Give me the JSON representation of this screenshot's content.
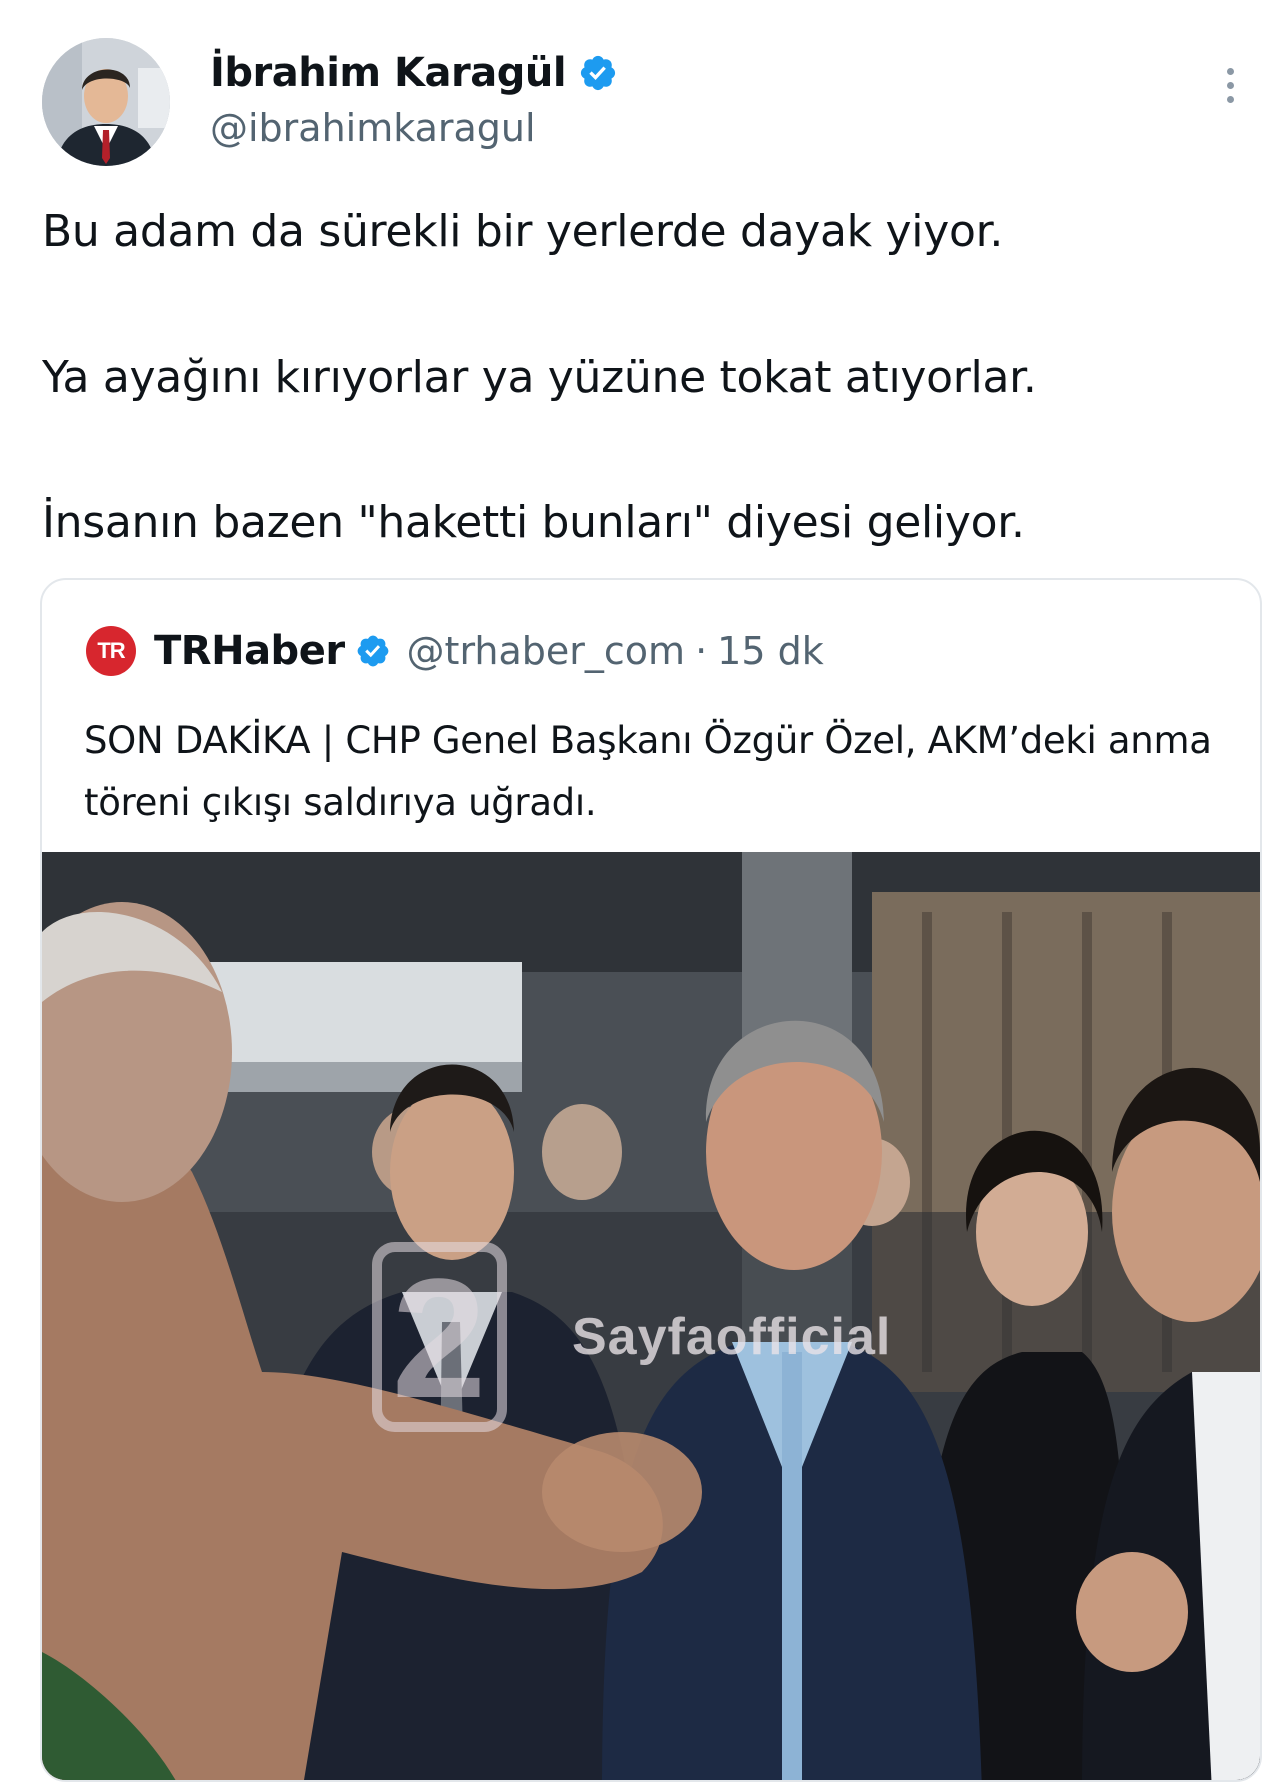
{
  "author": {
    "display_name": "İbrahim Karagül",
    "handle": "@ibrahimkaragul",
    "avatar_icon": "person-avatar",
    "verified_icon": "verified-badge-icon",
    "verified_color": "#1d9bf0"
  },
  "menu": {
    "icon": "more-vertical-icon"
  },
  "tweet": {
    "lines": [
      "Bu adam da sürekli bir yerlerde dayak yiyor.",
      "Ya ayağını kırıyorlar ya yüzüne tokat atıyorlar.",
      "İnsanın bazen \"haketti bunları\" diyesi geliyor."
    ]
  },
  "quote": {
    "logo_text": "TR",
    "logo_color": "#d7262e",
    "display_name": "TRHaber",
    "handle": "@trhaber_com",
    "separator": "·",
    "time": "15 dk",
    "text": "SON DAKİKA | CHP Genel Başkanı Özgür Özel, AKM’deki anma töreni çıkışı saldırıya uğradı.",
    "media": {
      "watermark_text": "Sayfaofficial",
      "watermark_logo": "2"
    }
  }
}
